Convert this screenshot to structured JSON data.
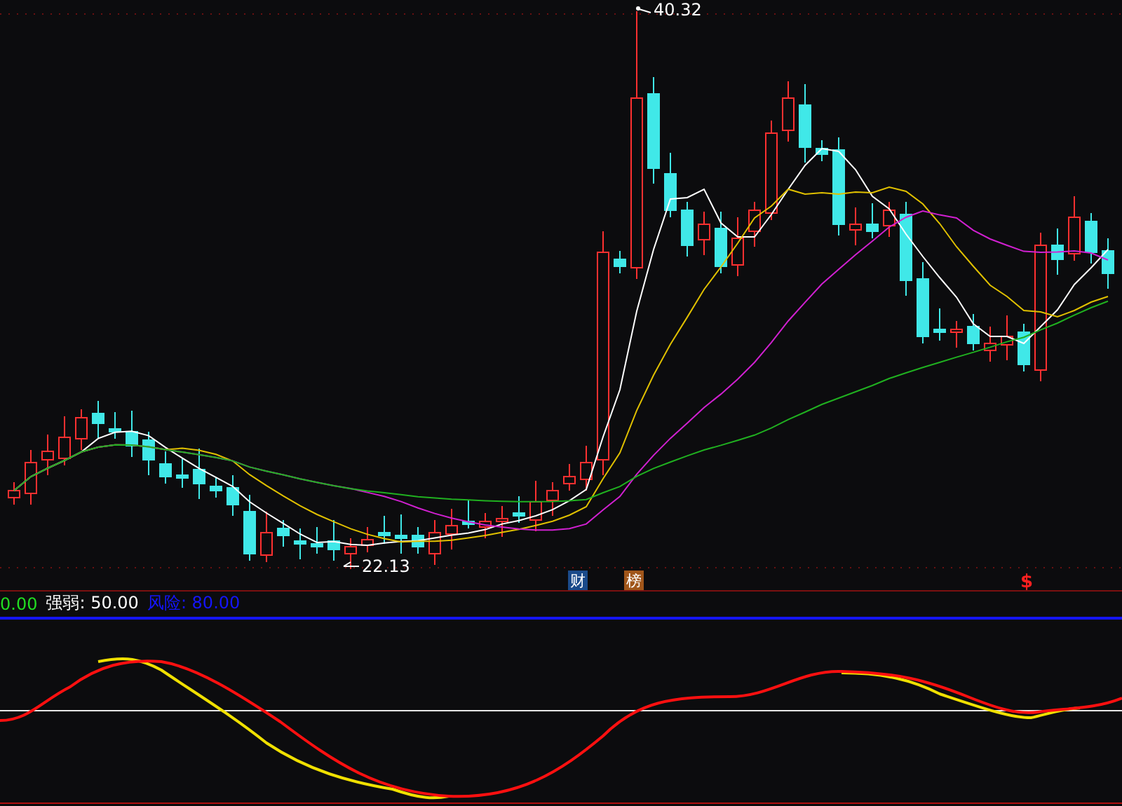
{
  "price_chart": {
    "high_label": "40.32",
    "low_label": "22.13",
    "event_markers": [
      {
        "text": "财",
        "kind": "box",
        "color": "#1a4a8a"
      },
      {
        "text": "榜",
        "kind": "box",
        "color": "#a0561a"
      },
      {
        "text": "$",
        "kind": "plain",
        "color": "#ff2020"
      }
    ]
  },
  "indicator": {
    "legend": [
      {
        "text": "0.00",
        "color": "#22dd22"
      },
      {
        "text": "强弱: 50.00",
        "color": "#ffffff"
      },
      {
        "text": "风险: 80.00",
        "color": "#1515ff"
      }
    ]
  }
}
